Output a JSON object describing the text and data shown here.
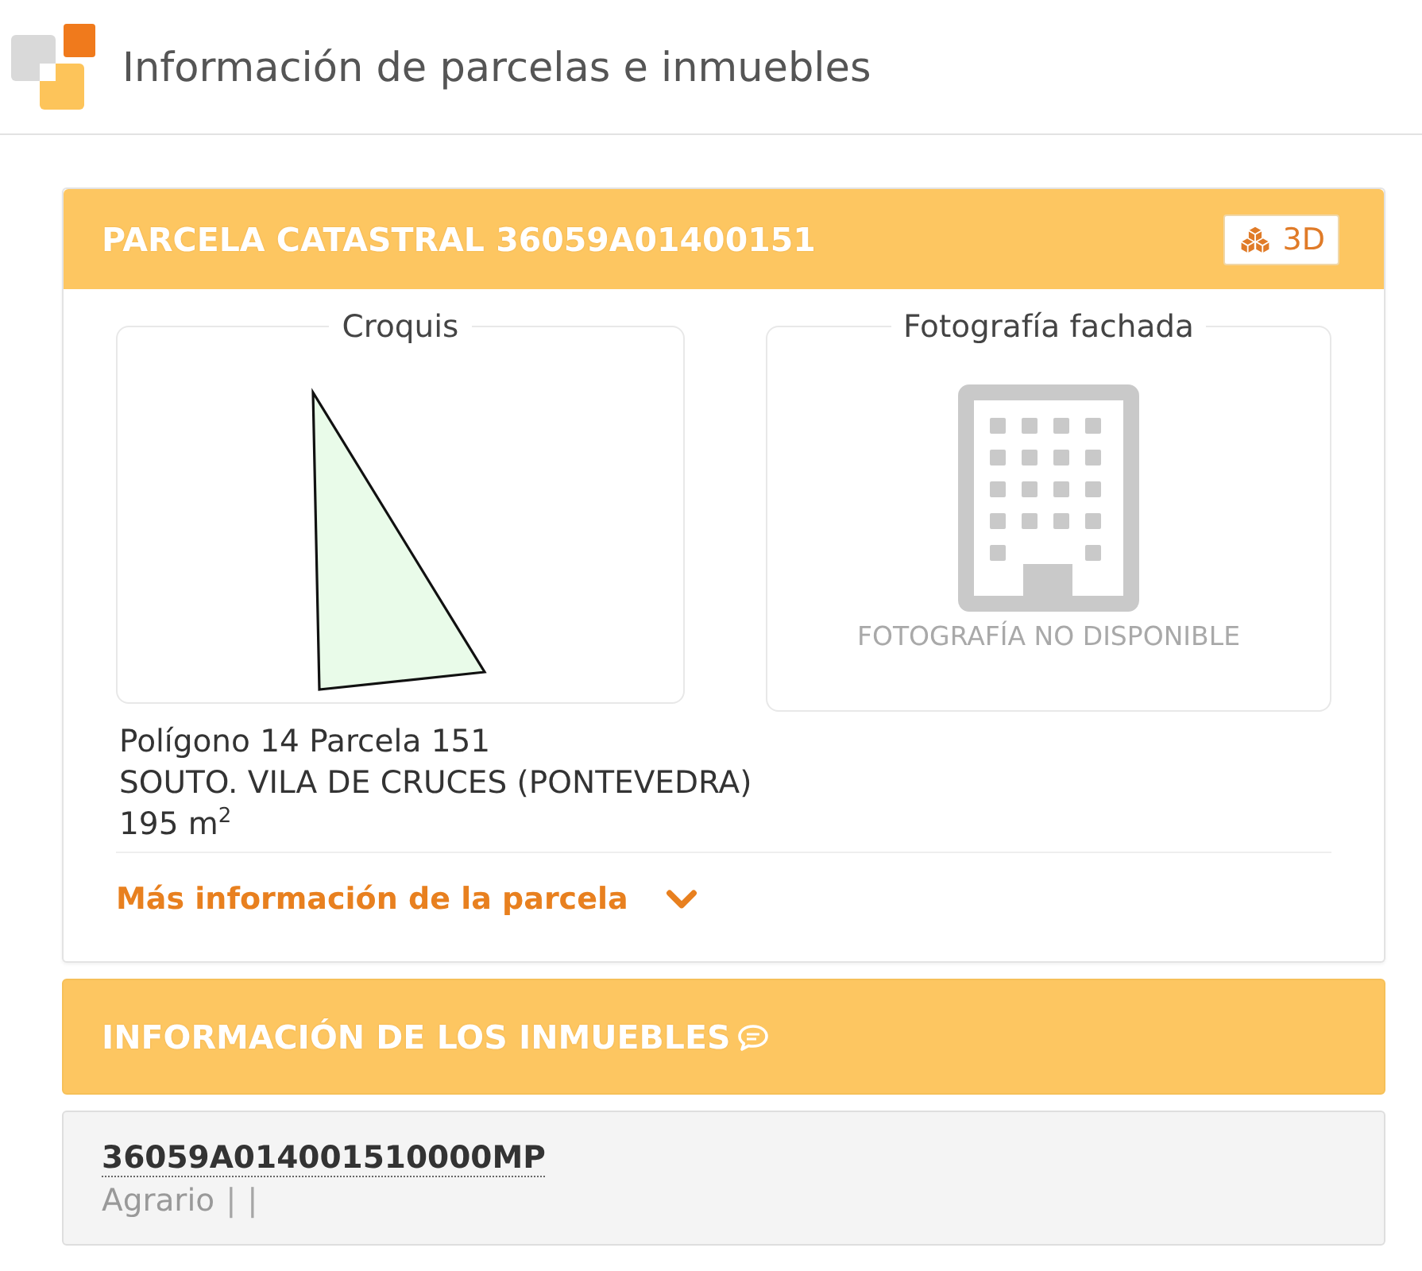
{
  "header": {
    "title": "Información de parcelas e inmuebles"
  },
  "parcel": {
    "title": "PARCELA CATASTRAL 36059A01400151",
    "view_3d_button": "3D",
    "sketch": {
      "legend": "Croquis"
    },
    "facade": {
      "legend": "Fotografía fachada",
      "unavailable_text": "FOTOGRAFÍA NO DISPONIBLE"
    },
    "details": [
      "Polígono 14 Parcela 151",
      "SOUTO. VILA DE CRUCES (PONTEVEDRA)",
      "195 m$^{2}$"
    ],
    "more_link": {
      "label": "Más información de la parcela",
      "expanded": false
    }
  },
  "properties": {
    "title": "INFORMACIÓN DE LOS INMUEBLES",
    "items": [
      {
        "reference": "36059A014001510000MP",
        "parts": [
          {
            "kind": "value",
            "text": "Agrario"
          },
          {
            "kind": "separator",
            "text": "|"
          },
          {
            "kind": "separator",
            "text": "|"
          }
        ]
      }
    ]
  }
}
